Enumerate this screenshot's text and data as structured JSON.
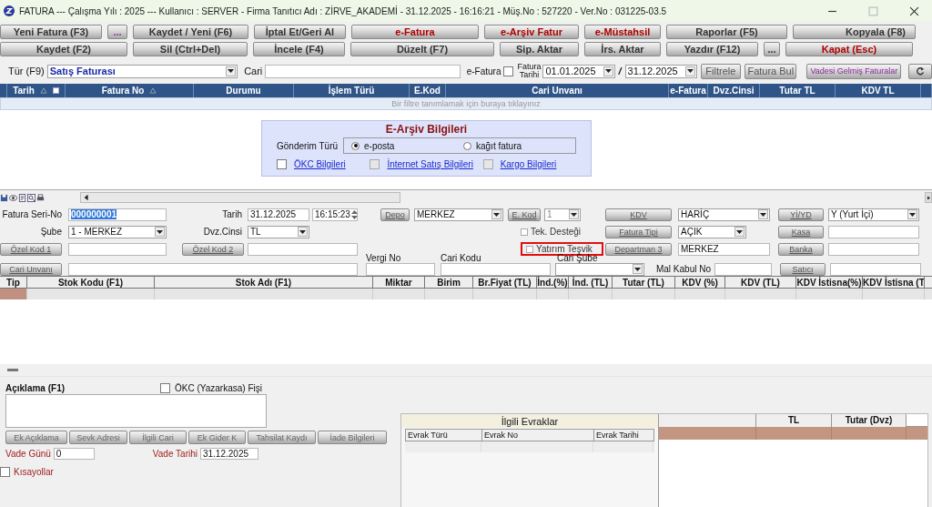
{
  "window": {
    "title": "FATURA  ---  Çalışma Yılı : 2025  ---  Kullanıcı : SERVER - Firma Tanıtıcı Adı : ZİRVE_AKADEMİ - 31.12.2025 - 16:16:21 - Müş.No : 527220 - Ver.No : 031225-03.5"
  },
  "toolbar": [
    [
      {
        "label": "Yeni Fatura (F3)",
        "kind": "normal"
      },
      {
        "label": "...",
        "kind": "purple"
      },
      {
        "label": "Kaydet / Yeni (F6)",
        "kind": "normal"
      },
      {
        "label": "İptal Et/Geri Al",
        "kind": "normal"
      },
      {
        "label": "e-Fatura",
        "kind": "red"
      },
      {
        "label": "e-Arşiv Fatur",
        "kind": "red"
      },
      {
        "label": "e-Müstahsil",
        "kind": "red"
      },
      {
        "label": "Raporlar (F5)",
        "kind": "normal"
      },
      {
        "label": "Kopyala (F8)",
        "kind": "normal"
      }
    ],
    [
      {
        "label": "Kaydet (F2)",
        "kind": "normal"
      },
      {
        "label": "Sil (Ctrl+Del)",
        "kind": "normal"
      },
      {
        "label": "İncele (F4)",
        "kind": "normal"
      },
      {
        "label": "Düzelt (F7)",
        "kind": "normal"
      },
      {
        "label": "Sip. Aktar",
        "kind": "normal"
      },
      {
        "label": "İrs. Aktar",
        "kind": "normal"
      },
      {
        "label": "Yazdır (F12)",
        "kind": "normal"
      },
      {
        "label": "...",
        "kind": "normal"
      },
      {
        "label": "Kapat (Esc)",
        "kind": "red"
      }
    ]
  ],
  "filter_bar": {
    "type_label": "Tür (F9)",
    "type_value": "Satış Faturası",
    "cari_label": "Cari",
    "efatura_label": "e-Fatura",
    "efatura_checked": false,
    "date_label": "Fatura Tarihi",
    "date_from": "01.01.2025",
    "date_separator": "/",
    "date_to": "31.12.2025",
    "buttons": [
      {
        "label": "Filtrele"
      },
      {
        "label": "Fatura Bul"
      },
      {
        "label": "Vadesi Gelmiş Faturalar"
      }
    ]
  },
  "invoice_list": {
    "columns": [
      {
        "label": "Tarih",
        "sort_mark": true,
        "filter_button": true
      },
      {
        "label": "Fatura No",
        "sort_mark": true,
        "filter_button": false
      },
      {
        "label": "Durumu",
        "sort_mark": false,
        "filter_button": false
      },
      {
        "label": "İşlem Türü",
        "sort_mark": false,
        "filter_button": false
      },
      {
        "label": "E.Kod",
        "sort_mark": false,
        "filter_button": false
      },
      {
        "label": "Cari Unvanı",
        "sort_mark": false,
        "filter_button": false
      },
      {
        "label": "e-Fatura",
        "sort_mark": false,
        "filter_button": false
      },
      {
        "label": "Dvz.Cinsi",
        "sort_mark": false,
        "filter_button": false
      },
      {
        "label": "Tutar TL",
        "sort_mark": false,
        "filter_button": false
      },
      {
        "label": "KDV TL",
        "sort_mark": false,
        "filter_button": false
      }
    ],
    "filter_hint": "Bir filtre tanımlamak için buraya tıklayınız"
  },
  "e_archive": {
    "title": "E-Arşiv Bilgileri",
    "send_label": "Gönderim Türü",
    "options": [
      {
        "label": "e-posta",
        "selected": true
      },
      {
        "label": "kağıt fatura",
        "selected": false
      }
    ],
    "links": [
      {
        "label": "ÖKC Bilgileri",
        "checked": false,
        "disabled": false
      },
      {
        "label": "İnternet Satış Bilgileri",
        "checked": false,
        "disabled": true
      },
      {
        "label": "Kargo Bilgileri",
        "checked": false,
        "disabled": true
      }
    ]
  },
  "form": {
    "invoice_serial": {
      "label": "Fatura Seri-No",
      "value": "000000001"
    },
    "date": {
      "label": "Tarih",
      "value": "31.12.2025",
      "time": "16:15:23"
    },
    "warehouse": {
      "button": "Depo",
      "value": "MERKEZ"
    },
    "e_code": {
      "button": "E. Kod",
      "value": "1",
      "disabled": true
    },
    "vat": {
      "button": "KDV",
      "value": "HARİÇ"
    },
    "domestic": {
      "button": "Yİ/YD",
      "value": "Y (Yurt İçi)"
    },
    "branch": {
      "label": "Şube",
      "value": "1 - MERKEZ"
    },
    "currency": {
      "label": "Dvz.Cinsi",
      "value": "TL"
    },
    "tech_support": {
      "label": "Tek. Desteği",
      "checked": false
    },
    "invoice_type": {
      "button": "Fatura Tipi",
      "value": "AÇIK"
    },
    "cash": {
      "button": "Kasa"
    },
    "special_code_1": {
      "button": "Özel Kod 1"
    },
    "special_code_2": {
      "button": "Özel Kod 2"
    },
    "investment_incentive": {
      "label": "Yatırım Teşvik",
      "checked": false,
      "highlighted": true
    },
    "department": {
      "button": "Departman 3",
      "value": "MERKEZ"
    },
    "bank": {
      "button": "Banka"
    },
    "tax_no": {
      "label": "Vergi No"
    },
    "account_code": {
      "label": "Cari Kodu"
    },
    "account_branch": {
      "label": "Cari Şube"
    },
    "account_title": {
      "button": "Cari Unvanı"
    },
    "delivery_no": {
      "label": "Mal Kabul No"
    },
    "seller": {
      "button": "Satıcı"
    }
  },
  "lines": {
    "columns": [
      "Tip",
      "Stok Kodu (F1)",
      "Stok Adı (F1)",
      "Miktar",
      "Birim",
      "Br.Fiyat (TL)",
      "İnd.(%)",
      "İnd. (TL)",
      "Tutar (TL)",
      "KDV (%)",
      "KDV (TL)",
      "KDV İstisna(%)",
      "KDV İstisna (T"
    ]
  },
  "notes": {
    "label": "Açıklama (F1)",
    "okc_label": "ÖKC (Yazarkasa) Fişi",
    "okc_checked": false,
    "buttons": [
      "Ek Açıklama",
      "Sevk Adresi",
      "İlgili Cari",
      "Ek Gider K",
      "Tahsilat Kaydı",
      "İade Bilgileri"
    ],
    "due_days_label": "Vade Günü",
    "due_days": "0",
    "due_date_label": "Vade Tarihi",
    "due_date": "31.12.2025",
    "shortcuts_label": "Kısayollar",
    "shortcuts_checked": false
  },
  "related_documents": {
    "title": "İlgili Evraklar",
    "columns": [
      "Evrak Türü",
      "Evrak No",
      "Evrak Tarihi"
    ]
  },
  "totals": {
    "columns": [
      "TL",
      "Tutar (Dvz)"
    ]
  }
}
